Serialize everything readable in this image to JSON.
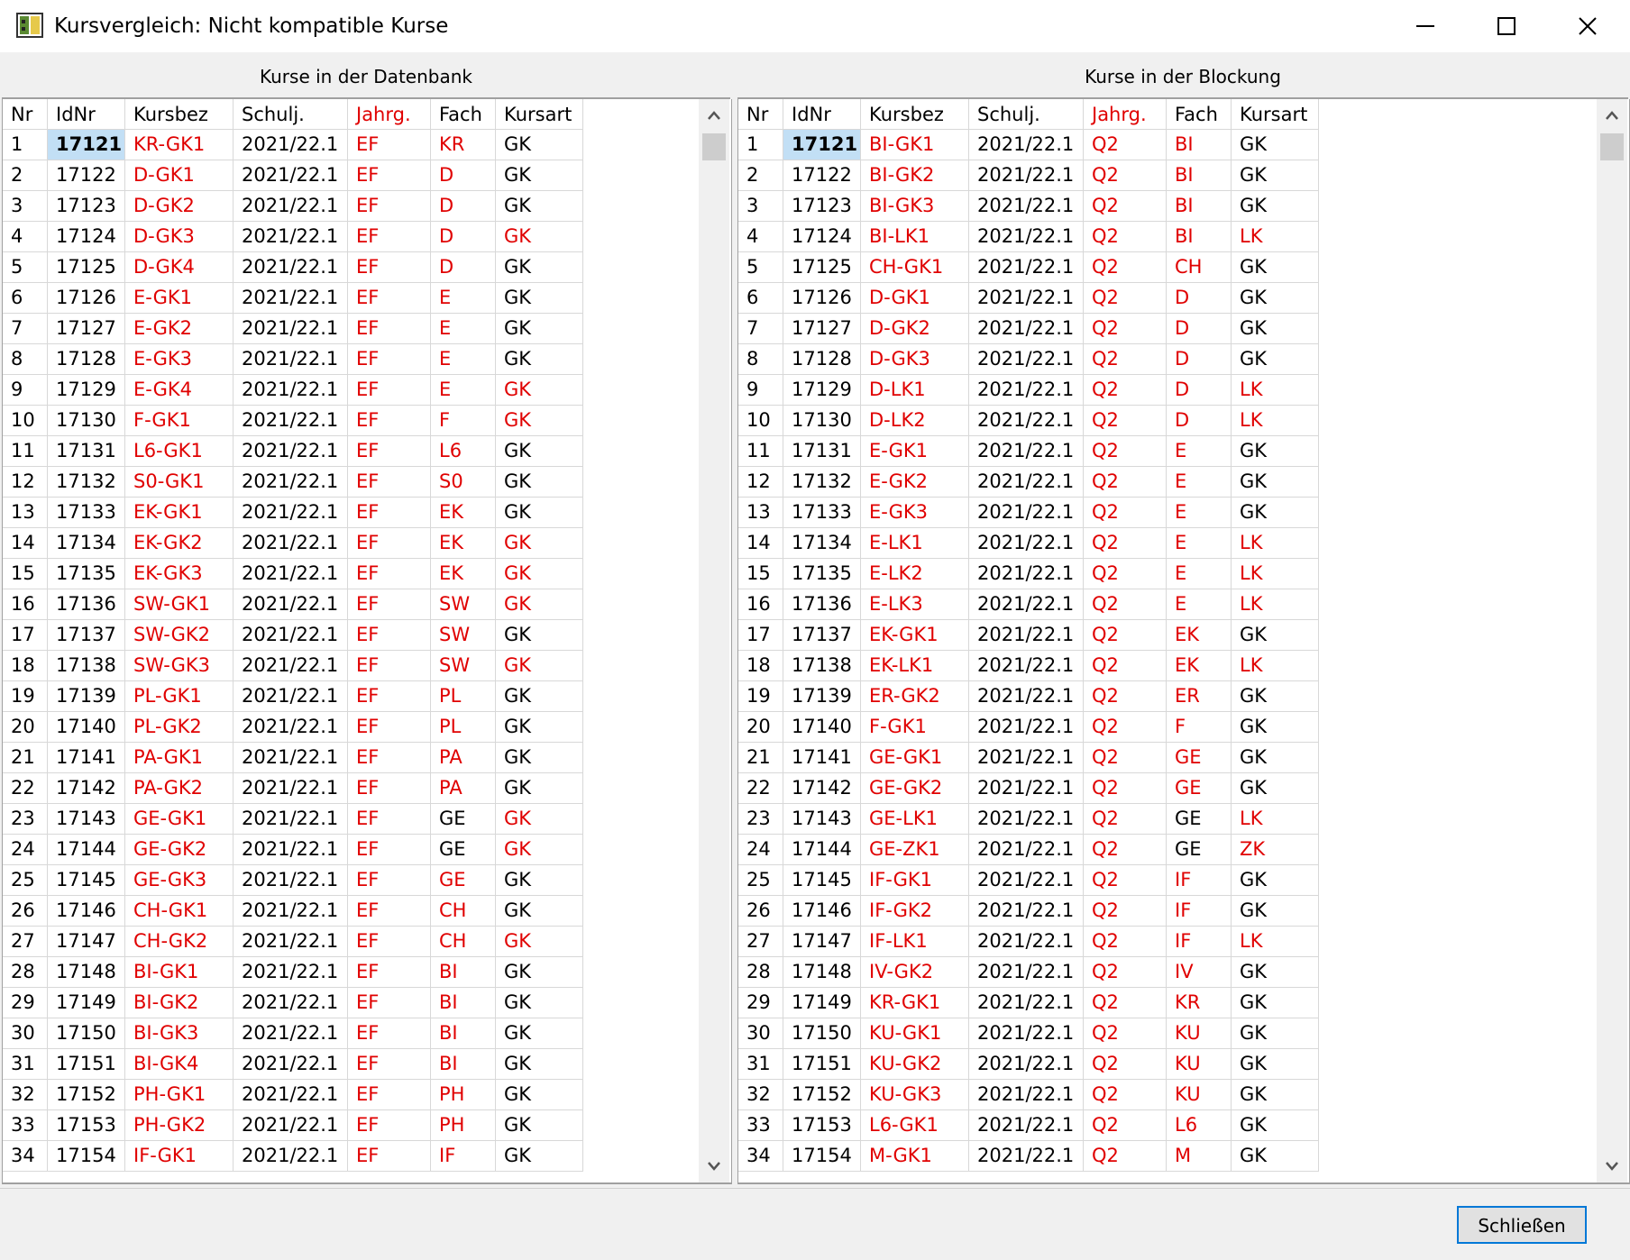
{
  "window": {
    "title": "Kursvergleich: Nicht kompatible Kurse",
    "minimize_label": "Minimieren",
    "maximize_label": "Maximieren",
    "close_label": "Schließen"
  },
  "columns": [
    "Nr",
    "IdNr",
    "Kursbez",
    "Schulj.",
    "Jahrg.",
    "Fach",
    "Kursart"
  ],
  "colors": {
    "mismatch": "#e00000",
    "selection": "#c2dff5",
    "accent": "#0078d7"
  },
  "left_panel": {
    "title": "Kurse in der Datenbank",
    "rows": [
      {
        "nr": "1",
        "idnr": "17121",
        "kursbez": "KR-GK1",
        "schulj": "2021/22.1",
        "jahrg": "EF",
        "fach": "KR",
        "kursart": "GK",
        "red": [
          2,
          4,
          5
        ],
        "selected": true
      },
      {
        "nr": "2",
        "idnr": "17122",
        "kursbez": "D-GK1",
        "schulj": "2021/22.1",
        "jahrg": "EF",
        "fach": "D",
        "kursart": "GK",
        "red": [
          2,
          4,
          5
        ]
      },
      {
        "nr": "3",
        "idnr": "17123",
        "kursbez": "D-GK2",
        "schulj": "2021/22.1",
        "jahrg": "EF",
        "fach": "D",
        "kursart": "GK",
        "red": [
          2,
          4,
          5
        ]
      },
      {
        "nr": "4",
        "idnr": "17124",
        "kursbez": "D-GK3",
        "schulj": "2021/22.1",
        "jahrg": "EF",
        "fach": "D",
        "kursart": "GK",
        "red": [
          2,
          4,
          5,
          6
        ]
      },
      {
        "nr": "5",
        "idnr": "17125",
        "kursbez": "D-GK4",
        "schulj": "2021/22.1",
        "jahrg": "EF",
        "fach": "D",
        "kursart": "GK",
        "red": [
          2,
          4,
          5
        ]
      },
      {
        "nr": "6",
        "idnr": "17126",
        "kursbez": "E-GK1",
        "schulj": "2021/22.1",
        "jahrg": "EF",
        "fach": "E",
        "kursart": "GK",
        "red": [
          2,
          4,
          5
        ]
      },
      {
        "nr": "7",
        "idnr": "17127",
        "kursbez": "E-GK2",
        "schulj": "2021/22.1",
        "jahrg": "EF",
        "fach": "E",
        "kursart": "GK",
        "red": [
          2,
          4,
          5
        ]
      },
      {
        "nr": "8",
        "idnr": "17128",
        "kursbez": "E-GK3",
        "schulj": "2021/22.1",
        "jahrg": "EF",
        "fach": "E",
        "kursart": "GK",
        "red": [
          2,
          4,
          5
        ]
      },
      {
        "nr": "9",
        "idnr": "17129",
        "kursbez": "E-GK4",
        "schulj": "2021/22.1",
        "jahrg": "EF",
        "fach": "E",
        "kursart": "GK",
        "red": [
          2,
          4,
          5,
          6
        ]
      },
      {
        "nr": "10",
        "idnr": "17130",
        "kursbez": "F-GK1",
        "schulj": "2021/22.1",
        "jahrg": "EF",
        "fach": "F",
        "kursart": "GK",
        "red": [
          2,
          4,
          5,
          6
        ]
      },
      {
        "nr": "11",
        "idnr": "17131",
        "kursbez": "L6-GK1",
        "schulj": "2021/22.1",
        "jahrg": "EF",
        "fach": "L6",
        "kursart": "GK",
        "red": [
          2,
          4,
          5
        ]
      },
      {
        "nr": "12",
        "idnr": "17132",
        "kursbez": "S0-GK1",
        "schulj": "2021/22.1",
        "jahrg": "EF",
        "fach": "S0",
        "kursart": "GK",
        "red": [
          2,
          4,
          5
        ]
      },
      {
        "nr": "13",
        "idnr": "17133",
        "kursbez": "EK-GK1",
        "schulj": "2021/22.1",
        "jahrg": "EF",
        "fach": "EK",
        "kursart": "GK",
        "red": [
          2,
          4,
          5
        ]
      },
      {
        "nr": "14",
        "idnr": "17134",
        "kursbez": "EK-GK2",
        "schulj": "2021/22.1",
        "jahrg": "EF",
        "fach": "EK",
        "kursart": "GK",
        "red": [
          2,
          4,
          5,
          6
        ]
      },
      {
        "nr": "15",
        "idnr": "17135",
        "kursbez": "EK-GK3",
        "schulj": "2021/22.1",
        "jahrg": "EF",
        "fach": "EK",
        "kursart": "GK",
        "red": [
          2,
          4,
          5,
          6
        ]
      },
      {
        "nr": "16",
        "idnr": "17136",
        "kursbez": "SW-GK1",
        "schulj": "2021/22.1",
        "jahrg": "EF",
        "fach": "SW",
        "kursart": "GK",
        "red": [
          2,
          4,
          5,
          6
        ]
      },
      {
        "nr": "17",
        "idnr": "17137",
        "kursbez": "SW-GK2",
        "schulj": "2021/22.1",
        "jahrg": "EF",
        "fach": "SW",
        "kursart": "GK",
        "red": [
          2,
          4,
          5
        ]
      },
      {
        "nr": "18",
        "idnr": "17138",
        "kursbez": "SW-GK3",
        "schulj": "2021/22.1",
        "jahrg": "EF",
        "fach": "SW",
        "kursart": "GK",
        "red": [
          2,
          4,
          5,
          6
        ]
      },
      {
        "nr": "19",
        "idnr": "17139",
        "kursbez": "PL-GK1",
        "schulj": "2021/22.1",
        "jahrg": "EF",
        "fach": "PL",
        "kursart": "GK",
        "red": [
          2,
          4,
          5
        ]
      },
      {
        "nr": "20",
        "idnr": "17140",
        "kursbez": "PL-GK2",
        "schulj": "2021/22.1",
        "jahrg": "EF",
        "fach": "PL",
        "kursart": "GK",
        "red": [
          2,
          4,
          5
        ]
      },
      {
        "nr": "21",
        "idnr": "17141",
        "kursbez": "PA-GK1",
        "schulj": "2021/22.1",
        "jahrg": "EF",
        "fach": "PA",
        "kursart": "GK",
        "red": [
          2,
          4,
          5
        ]
      },
      {
        "nr": "22",
        "idnr": "17142",
        "kursbez": "PA-GK2",
        "schulj": "2021/22.1",
        "jahrg": "EF",
        "fach": "PA",
        "kursart": "GK",
        "red": [
          2,
          4,
          5
        ]
      },
      {
        "nr": "23",
        "idnr": "17143",
        "kursbez": "GE-GK1",
        "schulj": "2021/22.1",
        "jahrg": "EF",
        "fach": "GE",
        "kursart": "GK",
        "red": [
          2,
          4,
          6
        ]
      },
      {
        "nr": "24",
        "idnr": "17144",
        "kursbez": "GE-GK2",
        "schulj": "2021/22.1",
        "jahrg": "EF",
        "fach": "GE",
        "kursart": "GK",
        "red": [
          2,
          4,
          6
        ]
      },
      {
        "nr": "25",
        "idnr": "17145",
        "kursbez": "GE-GK3",
        "schulj": "2021/22.1",
        "jahrg": "EF",
        "fach": "GE",
        "kursart": "GK",
        "red": [
          2,
          4,
          5
        ]
      },
      {
        "nr": "26",
        "idnr": "17146",
        "kursbez": "CH-GK1",
        "schulj": "2021/22.1",
        "jahrg": "EF",
        "fach": "CH",
        "kursart": "GK",
        "red": [
          2,
          4,
          5
        ]
      },
      {
        "nr": "27",
        "idnr": "17147",
        "kursbez": "CH-GK2",
        "schulj": "2021/22.1",
        "jahrg": "EF",
        "fach": "CH",
        "kursart": "GK",
        "red": [
          2,
          4,
          5,
          6
        ]
      },
      {
        "nr": "28",
        "idnr": "17148",
        "kursbez": "BI-GK1",
        "schulj": "2021/22.1",
        "jahrg": "EF",
        "fach": "BI",
        "kursart": "GK",
        "red": [
          2,
          4,
          5
        ]
      },
      {
        "nr": "29",
        "idnr": "17149",
        "kursbez": "BI-GK2",
        "schulj": "2021/22.1",
        "jahrg": "EF",
        "fach": "BI",
        "kursart": "GK",
        "red": [
          2,
          4,
          5
        ]
      },
      {
        "nr": "30",
        "idnr": "17150",
        "kursbez": "BI-GK3",
        "schulj": "2021/22.1",
        "jahrg": "EF",
        "fach": "BI",
        "kursart": "GK",
        "red": [
          2,
          4,
          5
        ]
      },
      {
        "nr": "31",
        "idnr": "17151",
        "kursbez": "BI-GK4",
        "schulj": "2021/22.1",
        "jahrg": "EF",
        "fach": "BI",
        "kursart": "GK",
        "red": [
          2,
          4,
          5
        ]
      },
      {
        "nr": "32",
        "idnr": "17152",
        "kursbez": "PH-GK1",
        "schulj": "2021/22.1",
        "jahrg": "EF",
        "fach": "PH",
        "kursart": "GK",
        "red": [
          2,
          4,
          5
        ]
      },
      {
        "nr": "33",
        "idnr": "17153",
        "kursbez": "PH-GK2",
        "schulj": "2021/22.1",
        "jahrg": "EF",
        "fach": "PH",
        "kursart": "GK",
        "red": [
          2,
          4,
          5
        ]
      },
      {
        "nr": "34",
        "idnr": "17154",
        "kursbez": "IF-GK1",
        "schulj": "2021/22.1",
        "jahrg": "EF",
        "fach": "IF",
        "kursart": "GK",
        "red": [
          2,
          4,
          5
        ]
      }
    ]
  },
  "right_panel": {
    "title": "Kurse in der Blockung",
    "rows": [
      {
        "nr": "1",
        "idnr": "17121",
        "kursbez": "BI-GK1",
        "schulj": "2021/22.1",
        "jahrg": "Q2",
        "fach": "BI",
        "kursart": "GK",
        "red": [
          2,
          4,
          5
        ],
        "selected": true
      },
      {
        "nr": "2",
        "idnr": "17122",
        "kursbez": "BI-GK2",
        "schulj": "2021/22.1",
        "jahrg": "Q2",
        "fach": "BI",
        "kursart": "GK",
        "red": [
          2,
          4,
          5
        ]
      },
      {
        "nr": "3",
        "idnr": "17123",
        "kursbez": "BI-GK3",
        "schulj": "2021/22.1",
        "jahrg": "Q2",
        "fach": "BI",
        "kursart": "GK",
        "red": [
          2,
          4,
          5
        ]
      },
      {
        "nr": "4",
        "idnr": "17124",
        "kursbez": "BI-LK1",
        "schulj": "2021/22.1",
        "jahrg": "Q2",
        "fach": "BI",
        "kursart": "LK",
        "red": [
          2,
          4,
          5,
          6
        ]
      },
      {
        "nr": "5",
        "idnr": "17125",
        "kursbez": "CH-GK1",
        "schulj": "2021/22.1",
        "jahrg": "Q2",
        "fach": "CH",
        "kursart": "GK",
        "red": [
          2,
          4,
          5
        ]
      },
      {
        "nr": "6",
        "idnr": "17126",
        "kursbez": "D-GK1",
        "schulj": "2021/22.1",
        "jahrg": "Q2",
        "fach": "D",
        "kursart": "GK",
        "red": [
          2,
          4,
          5
        ]
      },
      {
        "nr": "7",
        "idnr": "17127",
        "kursbez": "D-GK2",
        "schulj": "2021/22.1",
        "jahrg": "Q2",
        "fach": "D",
        "kursart": "GK",
        "red": [
          2,
          4,
          5
        ]
      },
      {
        "nr": "8",
        "idnr": "17128",
        "kursbez": "D-GK3",
        "schulj": "2021/22.1",
        "jahrg": "Q2",
        "fach": "D",
        "kursart": "GK",
        "red": [
          2,
          4,
          5
        ]
      },
      {
        "nr": "9",
        "idnr": "17129",
        "kursbez": "D-LK1",
        "schulj": "2021/22.1",
        "jahrg": "Q2",
        "fach": "D",
        "kursart": "LK",
        "red": [
          2,
          4,
          5,
          6
        ]
      },
      {
        "nr": "10",
        "idnr": "17130",
        "kursbez": "D-LK2",
        "schulj": "2021/22.1",
        "jahrg": "Q2",
        "fach": "D",
        "kursart": "LK",
        "red": [
          2,
          4,
          5,
          6
        ]
      },
      {
        "nr": "11",
        "idnr": "17131",
        "kursbez": "E-GK1",
        "schulj": "2021/22.1",
        "jahrg": "Q2",
        "fach": "E",
        "kursart": "GK",
        "red": [
          2,
          4,
          5
        ]
      },
      {
        "nr": "12",
        "idnr": "17132",
        "kursbez": "E-GK2",
        "schulj": "2021/22.1",
        "jahrg": "Q2",
        "fach": "E",
        "kursart": "GK",
        "red": [
          2,
          4,
          5
        ]
      },
      {
        "nr": "13",
        "idnr": "17133",
        "kursbez": "E-GK3",
        "schulj": "2021/22.1",
        "jahrg": "Q2",
        "fach": "E",
        "kursart": "GK",
        "red": [
          2,
          4,
          5
        ]
      },
      {
        "nr": "14",
        "idnr": "17134",
        "kursbez": "E-LK1",
        "schulj": "2021/22.1",
        "jahrg": "Q2",
        "fach": "E",
        "kursart": "LK",
        "red": [
          2,
          4,
          5,
          6
        ]
      },
      {
        "nr": "15",
        "idnr": "17135",
        "kursbez": "E-LK2",
        "schulj": "2021/22.1",
        "jahrg": "Q2",
        "fach": "E",
        "kursart": "LK",
        "red": [
          2,
          4,
          5,
          6
        ]
      },
      {
        "nr": "16",
        "idnr": "17136",
        "kursbez": "E-LK3",
        "schulj": "2021/22.1",
        "jahrg": "Q2",
        "fach": "E",
        "kursart": "LK",
        "red": [
          2,
          4,
          5,
          6
        ]
      },
      {
        "nr": "17",
        "idnr": "17137",
        "kursbez": "EK-GK1",
        "schulj": "2021/22.1",
        "jahrg": "Q2",
        "fach": "EK",
        "kursart": "GK",
        "red": [
          2,
          4,
          5
        ]
      },
      {
        "nr": "18",
        "idnr": "17138",
        "kursbez": "EK-LK1",
        "schulj": "2021/22.1",
        "jahrg": "Q2",
        "fach": "EK",
        "kursart": "LK",
        "red": [
          2,
          4,
          5,
          6
        ]
      },
      {
        "nr": "19",
        "idnr": "17139",
        "kursbez": "ER-GK2",
        "schulj": "2021/22.1",
        "jahrg": "Q2",
        "fach": "ER",
        "kursart": "GK",
        "red": [
          2,
          4,
          5
        ]
      },
      {
        "nr": "20",
        "idnr": "17140",
        "kursbez": "F-GK1",
        "schulj": "2021/22.1",
        "jahrg": "Q2",
        "fach": "F",
        "kursart": "GK",
        "red": [
          2,
          4,
          5
        ]
      },
      {
        "nr": "21",
        "idnr": "17141",
        "kursbez": "GE-GK1",
        "schulj": "2021/22.1",
        "jahrg": "Q2",
        "fach": "GE",
        "kursart": "GK",
        "red": [
          2,
          4,
          5
        ]
      },
      {
        "nr": "22",
        "idnr": "17142",
        "kursbez": "GE-GK2",
        "schulj": "2021/22.1",
        "jahrg": "Q2",
        "fach": "GE",
        "kursart": "GK",
        "red": [
          2,
          4,
          5
        ]
      },
      {
        "nr": "23",
        "idnr": "17143",
        "kursbez": "GE-LK1",
        "schulj": "2021/22.1",
        "jahrg": "Q2",
        "fach": "GE",
        "kursart": "LK",
        "red": [
          2,
          4,
          6
        ]
      },
      {
        "nr": "24",
        "idnr": "17144",
        "kursbez": "GE-ZK1",
        "schulj": "2021/22.1",
        "jahrg": "Q2",
        "fach": "GE",
        "kursart": "ZK",
        "red": [
          2,
          4,
          6
        ]
      },
      {
        "nr": "25",
        "idnr": "17145",
        "kursbez": "IF-GK1",
        "schulj": "2021/22.1",
        "jahrg": "Q2",
        "fach": "IF",
        "kursart": "GK",
        "red": [
          2,
          4,
          5
        ]
      },
      {
        "nr": "26",
        "idnr": "17146",
        "kursbez": "IF-GK2",
        "schulj": "2021/22.1",
        "jahrg": "Q2",
        "fach": "IF",
        "kursart": "GK",
        "red": [
          2,
          4,
          5
        ]
      },
      {
        "nr": "27",
        "idnr": "17147",
        "kursbez": "IF-LK1",
        "schulj": "2021/22.1",
        "jahrg": "Q2",
        "fach": "IF",
        "kursart": "LK",
        "red": [
          2,
          4,
          5,
          6
        ]
      },
      {
        "nr": "28",
        "idnr": "17148",
        "kursbez": "IV-GK2",
        "schulj": "2021/22.1",
        "jahrg": "Q2",
        "fach": "IV",
        "kursart": "GK",
        "red": [
          2,
          4,
          5
        ]
      },
      {
        "nr": "29",
        "idnr": "17149",
        "kursbez": "KR-GK1",
        "schulj": "2021/22.1",
        "jahrg": "Q2",
        "fach": "KR",
        "kursart": "GK",
        "red": [
          2,
          4,
          5
        ]
      },
      {
        "nr": "30",
        "idnr": "17150",
        "kursbez": "KU-GK1",
        "schulj": "2021/22.1",
        "jahrg": "Q2",
        "fach": "KU",
        "kursart": "GK",
        "red": [
          2,
          4,
          5
        ]
      },
      {
        "nr": "31",
        "idnr": "17151",
        "kursbez": "KU-GK2",
        "schulj": "2021/22.1",
        "jahrg": "Q2",
        "fach": "KU",
        "kursart": "GK",
        "red": [
          2,
          4,
          5
        ]
      },
      {
        "nr": "32",
        "idnr": "17152",
        "kursbez": "KU-GK3",
        "schulj": "2021/22.1",
        "jahrg": "Q2",
        "fach": "KU",
        "kursart": "GK",
        "red": [
          2,
          4,
          5
        ]
      },
      {
        "nr": "33",
        "idnr": "17153",
        "kursbez": "L6-GK1",
        "schulj": "2021/22.1",
        "jahrg": "Q2",
        "fach": "L6",
        "kursart": "GK",
        "red": [
          2,
          4,
          5
        ]
      },
      {
        "nr": "34",
        "idnr": "17154",
        "kursbez": "M-GK1",
        "schulj": "2021/22.1",
        "jahrg": "Q2",
        "fach": "M",
        "kursart": "GK",
        "red": [
          2,
          4,
          5
        ]
      }
    ]
  },
  "footer": {
    "close_button_label": "Schließen"
  }
}
